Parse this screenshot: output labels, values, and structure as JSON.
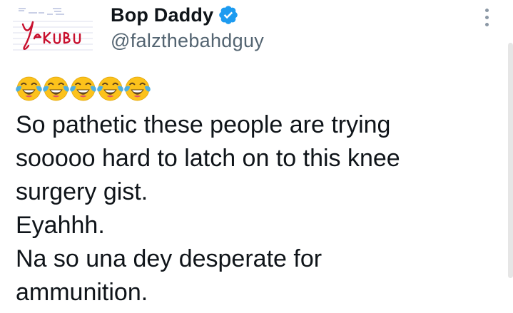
{
  "tweet": {
    "author": {
      "display_name": "Bop Daddy",
      "handle": "@falzthebahdguy",
      "verified": true,
      "avatar_logo_text": "YAKUBU"
    },
    "emojis": [
      "face-with-tears-of-joy",
      "face-with-tears-of-joy",
      "face-with-tears-of-joy",
      "face-with-tears-of-joy",
      "face-with-tears-of-joy"
    ],
    "text_lines": [
      "So pathetic these people are trying",
      "sooooo hard to latch on to this knee",
      "surgery gist.",
      "Eyahhh.",
      "Na so una dey desperate for",
      "ammunition."
    ]
  },
  "colors": {
    "text_primary": "#0f1419",
    "text_secondary": "#536471",
    "verified_blue": "#1d9bf0",
    "avatar_red": "#c8102e",
    "emoji_yellow": "#fcc21b",
    "tear_blue": "#4fafdf"
  },
  "icons": {
    "verified": "verified-badge-icon",
    "more": "more-options-icon",
    "emoji": "face-with-tears-of-joy-icon"
  }
}
